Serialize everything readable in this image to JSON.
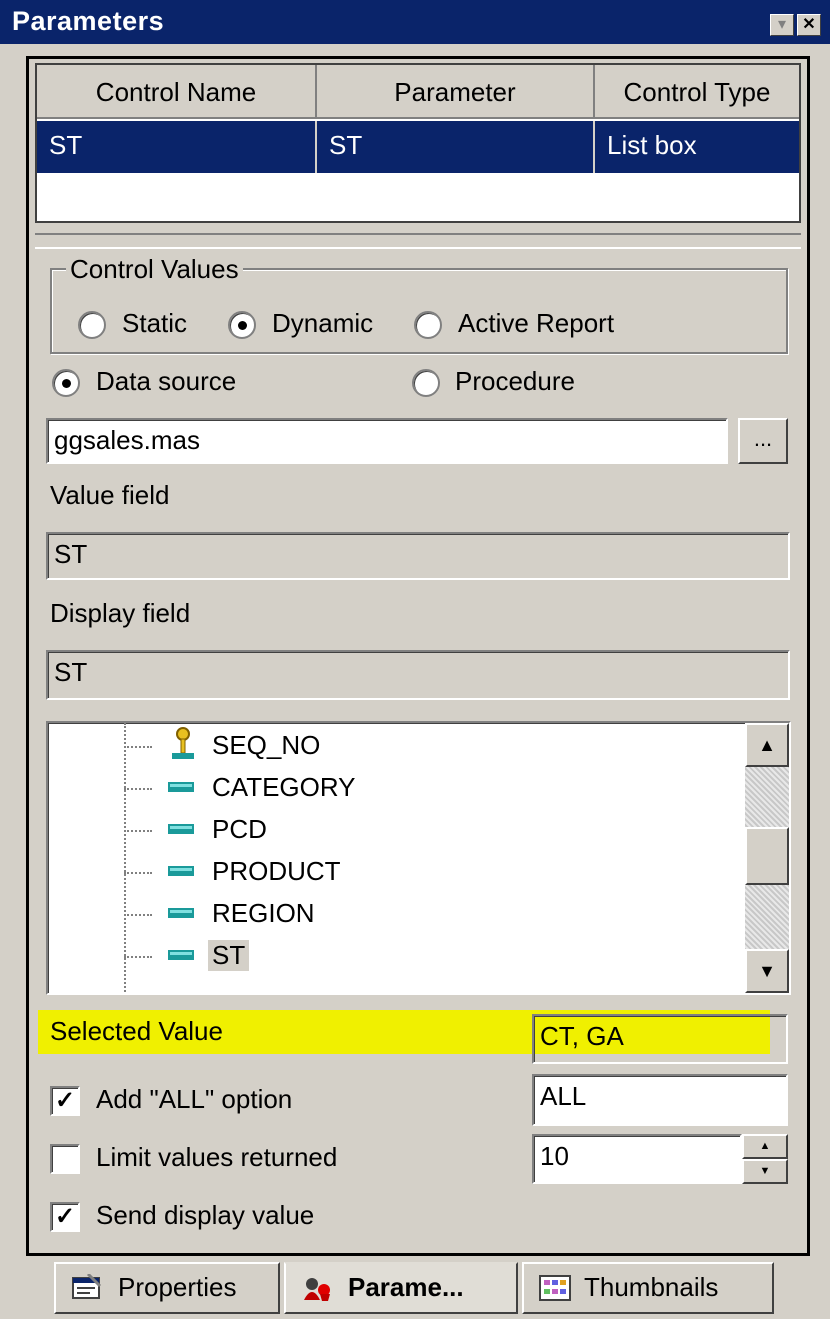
{
  "window": {
    "title": "Parameters",
    "close_glyph": "✕",
    "dropdown_glyph": "▾"
  },
  "table": {
    "headers": [
      "Control Name",
      "Parameter",
      "Control Type"
    ],
    "rows": [
      [
        "ST",
        "ST",
        "List box"
      ]
    ]
  },
  "control_values": {
    "legend": "Control Values",
    "options": [
      "Static",
      "Dynamic",
      "Active Report"
    ],
    "selected": "Dynamic",
    "source_options": [
      "Data source",
      "Procedure"
    ],
    "source_selected": "Data source"
  },
  "data_source": {
    "value": "ggsales.mas",
    "browse_label": "..."
  },
  "value_field": {
    "label": "Value field",
    "value": "ST"
  },
  "display_field": {
    "label": "Display field",
    "value": "ST"
  },
  "tree": {
    "items": [
      "SEQ_NO",
      "CATEGORY",
      "PCD",
      "PRODUCT",
      "REGION",
      "ST"
    ],
    "selected": "ST",
    "item_icons": [
      "key-icon",
      "field-icon",
      "field-icon",
      "field-icon",
      "field-icon",
      "field-icon"
    ]
  },
  "selected_value": {
    "label": "Selected Value",
    "value": "CT, GA",
    "highlight_color": "#f0f000"
  },
  "options": {
    "add_all": {
      "label": "Add \"ALL\" option",
      "checked": true,
      "value": "ALL"
    },
    "limit": {
      "label": "Limit values returned",
      "checked": false,
      "value": "10"
    },
    "send_display": {
      "label": "Send display value",
      "checked": true
    }
  },
  "tabs": [
    {
      "label": "Properties",
      "icon": "properties-icon",
      "active": false
    },
    {
      "label": "Parame...",
      "icon": "parameters-icon",
      "active": true
    },
    {
      "label": "Thumbnails",
      "icon": "thumbnails-icon",
      "active": false
    }
  ],
  "colors": {
    "title_bar": "#0a246a",
    "selection": "#0a246a",
    "face": "#d4d0c8"
  }
}
